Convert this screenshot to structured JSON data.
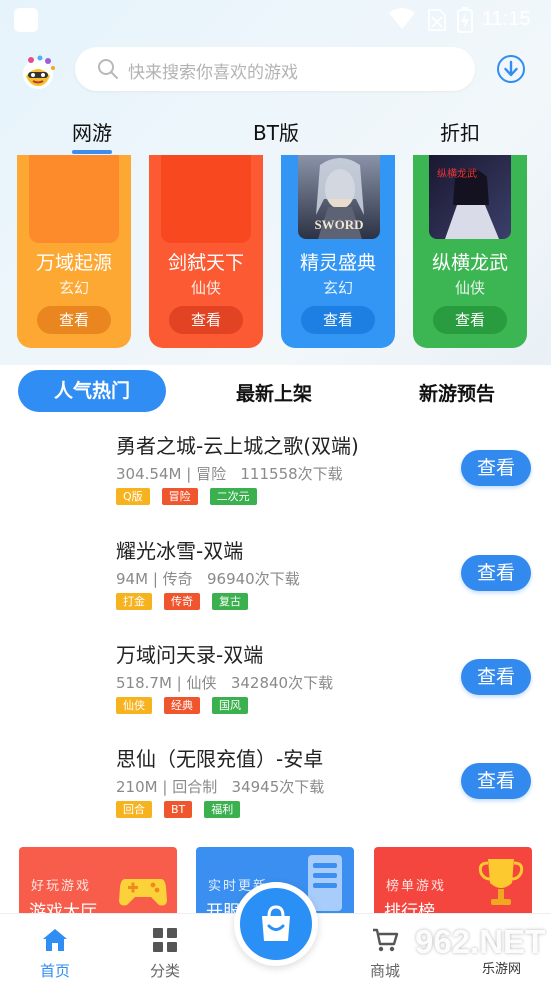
{
  "status_bar": {
    "time": "11:15"
  },
  "search": {
    "placeholder": "快来搜索你喜欢的游戏"
  },
  "top_tabs": [
    {
      "label": "网游",
      "active": true
    },
    {
      "label": "BT版",
      "active": false
    },
    {
      "label": "折扣",
      "active": false
    }
  ],
  "featured": [
    {
      "name": "万域起源",
      "genre": "玄幻",
      "button": "查看",
      "color": "#fca832",
      "btn_color": "#e98620"
    },
    {
      "name": "剑弑天下",
      "genre": "仙侠",
      "button": "查看",
      "color": "#fb5a33",
      "btn_color": "#e24322"
    },
    {
      "name": "精灵盛典",
      "genre": "玄幻",
      "button": "查看",
      "color": "#3396f5",
      "btn_color": "#1e7fe2",
      "art_text": "SWORD"
    },
    {
      "name": "纵横龙武",
      "genre": "仙侠",
      "button": "查看",
      "color": "#3cb652",
      "btn_color": "#2a9c40",
      "art_text": "纵横龙武"
    }
  ],
  "section_tabs": [
    {
      "label": "人气热门",
      "active": true
    },
    {
      "label": "最新上架",
      "active": false
    },
    {
      "label": "新游预告",
      "active": false
    }
  ],
  "games": [
    {
      "title": "勇者之城-云上城之歌(双端)",
      "size": "304.54M",
      "genre": "冒险",
      "downloads": "111558次下载",
      "tags": [
        {
          "text": "Q版",
          "color": "orange"
        },
        {
          "text": "冒险",
          "color": "red"
        },
        {
          "text": "二次元",
          "color": "green"
        }
      ],
      "button": "查看"
    },
    {
      "title": "耀光冰雪-双端",
      "size": "94M",
      "genre": "传奇",
      "downloads": "96940次下载",
      "tags": [
        {
          "text": "打金",
          "color": "orange"
        },
        {
          "text": "传奇",
          "color": "red"
        },
        {
          "text": "复古",
          "color": "green"
        }
      ],
      "button": "查看"
    },
    {
      "title": "万域问天录-双端",
      "size": "518.7M",
      "genre": "仙侠",
      "downloads": "342840次下载",
      "tags": [
        {
          "text": "仙侠",
          "color": "orange"
        },
        {
          "text": "经典",
          "color": "red"
        },
        {
          "text": "国风",
          "color": "green"
        }
      ],
      "button": "查看"
    },
    {
      "title": "思仙（无限充值）-安卓",
      "size": "210M",
      "genre": "回合制",
      "downloads": "34945次下载",
      "tags": [
        {
          "text": "回合",
          "color": "orange"
        },
        {
          "text": "BT",
          "color": "red"
        },
        {
          "text": "福利",
          "color": "green"
        }
      ],
      "button": "查看"
    }
  ],
  "banners": [
    {
      "line1": "好玩游戏",
      "line2": "游戏大厅",
      "color": "#f85c4a"
    },
    {
      "line1": "实时更新",
      "line2": "开服",
      "color": "#3b8ff0"
    },
    {
      "line1": "榜单游戏",
      "line2": "排行榜",
      "color": "#f4463e"
    }
  ],
  "bottom_nav": [
    {
      "label": "首页",
      "active": true
    },
    {
      "label": "分类",
      "active": false
    },
    {
      "label": "商城",
      "active": false
    }
  ],
  "watermark": {
    "text": "962.NET",
    "sub": "乐游网"
  }
}
